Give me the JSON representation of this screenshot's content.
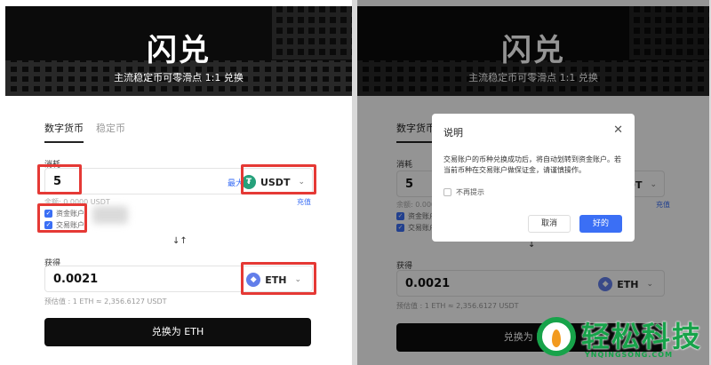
{
  "hero": {
    "title": "闪兑",
    "subtitle": "主流稳定币可零滑点 1:1 兑换"
  },
  "tabs": [
    {
      "label": "数字货币"
    },
    {
      "label": "稳定币"
    }
  ],
  "pay": {
    "label": "消耗",
    "amount": "5",
    "max_label": "最大",
    "coin": "USDT",
    "balance_label": "余额: 0.0000 USDT",
    "recharge_label": "充值",
    "accounts": [
      {
        "label": "资金账户",
        "checked": true
      },
      {
        "label": "交易账户",
        "checked": true
      }
    ]
  },
  "receive": {
    "label": "获得",
    "amount": "0.0021",
    "coin": "ETH",
    "estimate_label": "预估值 : 1 ETH ≈ 2,356.6127 USDT"
  },
  "cta_label": "兑换为 ETH",
  "modal": {
    "title": "说明",
    "body": "交易账户的币种兑换成功后，将自动划转到资金账户。若当前币种在交易账户做保证金，请谨慎操作。",
    "no_remind_label": "不再提示",
    "cancel_label": "取消",
    "ok_label": "好的"
  },
  "watermark": {
    "name": "轻松科技",
    "url": "YNQINGSONG.COM"
  },
  "colors": {
    "accent": "#3b6ff5",
    "highlight": "#e53935",
    "usdt": "#26a17b",
    "eth": "#627eea",
    "brand_green": "#17a34a"
  }
}
